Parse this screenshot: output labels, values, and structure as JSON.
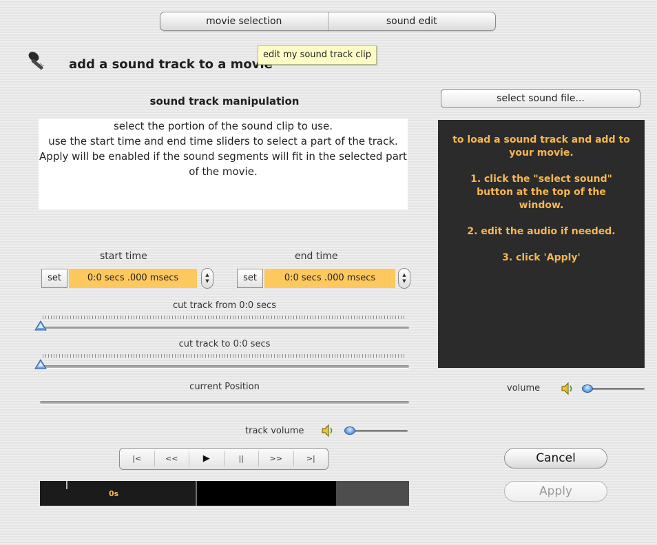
{
  "tabs": [
    {
      "label": "movie selection"
    },
    {
      "label": "sound edit"
    }
  ],
  "tooltip": "edit my sound track clip",
  "app": {
    "title": "add a sound track to a movie",
    "icon": "microphone-icon"
  },
  "manipulation": {
    "heading": "sound track manipulation",
    "instructions": "select the portion of the sound clip to use.\nuse the start time and end time sliders to select a part of the track.\nApply will be enabled if the sound segments will fit in the selected part of the movie."
  },
  "start_time": {
    "label": "start time",
    "set_label": "set",
    "value": "0:0 secs .000 msecs"
  },
  "end_time": {
    "label": "end time",
    "set_label": "set",
    "value": "0:0 secs .000 msecs"
  },
  "cut_from": {
    "label": "cut track from 0:0 secs",
    "position": 0
  },
  "cut_to": {
    "label": "cut track to 0:0 secs",
    "position": 0
  },
  "current_position": {
    "label": "current Position"
  },
  "track_volume": {
    "label": "track volume",
    "icon": "speaker-icon",
    "level": 0
  },
  "transport": {
    "buttons": [
      "|<",
      "<<",
      "▶",
      "||",
      ">>",
      ">|"
    ]
  },
  "timeline": {
    "time_label": "0s"
  },
  "select_sound_button": "select sound file...",
  "help": {
    "intro": "to load a sound track and add to your movie.",
    "steps": [
      "1. click the \"select sound\" button at the top of the window.",
      "2. edit the audio if needed.",
      "3. click 'Apply'"
    ]
  },
  "volume": {
    "label": "volume",
    "icon": "speaker-icon",
    "level": 0
  },
  "cancel_button": "Cancel",
  "apply_button": "Apply",
  "colors": {
    "accent_orange": "#fdc85e",
    "help_text": "#f8b750",
    "help_background": "#2b2b2b",
    "tooltip_background": "#fdfcc4"
  }
}
